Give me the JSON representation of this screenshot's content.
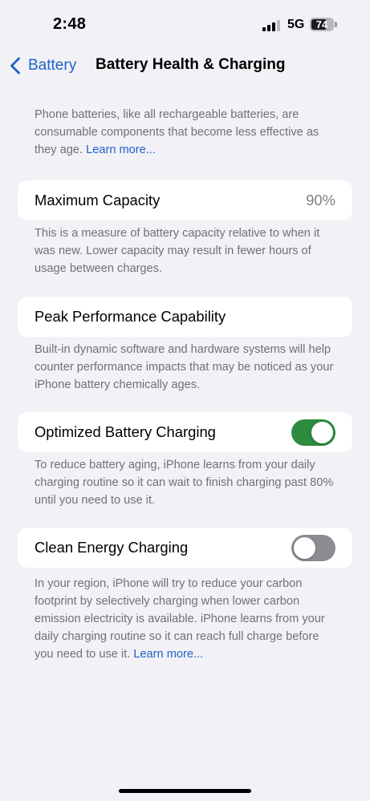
{
  "status_bar": {
    "time": "2:48",
    "network": "5G",
    "battery_percent": "74",
    "battery_level": 0.74,
    "signal_icon": "cellular-signal-icon"
  },
  "nav": {
    "back_label": "Battery",
    "back_icon": "chevron-left-icon",
    "title": "Battery Health & Charging"
  },
  "intro": {
    "text": "Phone batteries, like all rechargeable batteries, are consumable components that become less effective as they age.",
    "link": "Learn more..."
  },
  "maximum_capacity": {
    "label": "Maximum Capacity",
    "value": "90%",
    "description": "This is a measure of battery capacity relative to when it was new. Lower capacity may result in fewer hours of usage between charges."
  },
  "peak_performance": {
    "label": "Peak Performance Capability",
    "description": "Built-in dynamic software and hardware systems will help counter performance impacts that may be noticed as your iPhone battery chemically ages."
  },
  "optimized_charging": {
    "label": "Optimized Battery Charging",
    "enabled": true,
    "description": "To reduce battery aging, iPhone learns from your daily charging routine so it can wait to finish charging past 80% until you need to use it."
  },
  "clean_energy": {
    "label": "Clean Energy Charging",
    "enabled": false,
    "description": "In your region, iPhone will try to reduce your carbon footprint by selectively charging when lower carbon emission electricity is available. iPhone learns from your daily charging routine so it can reach full charge before you need to use it.",
    "link": "Learn more..."
  },
  "colors": {
    "accent": "#1f62c8",
    "toggle_on": "#2d8c40",
    "toggle_off": "#8c8c92",
    "background": "#f2f1f6"
  }
}
